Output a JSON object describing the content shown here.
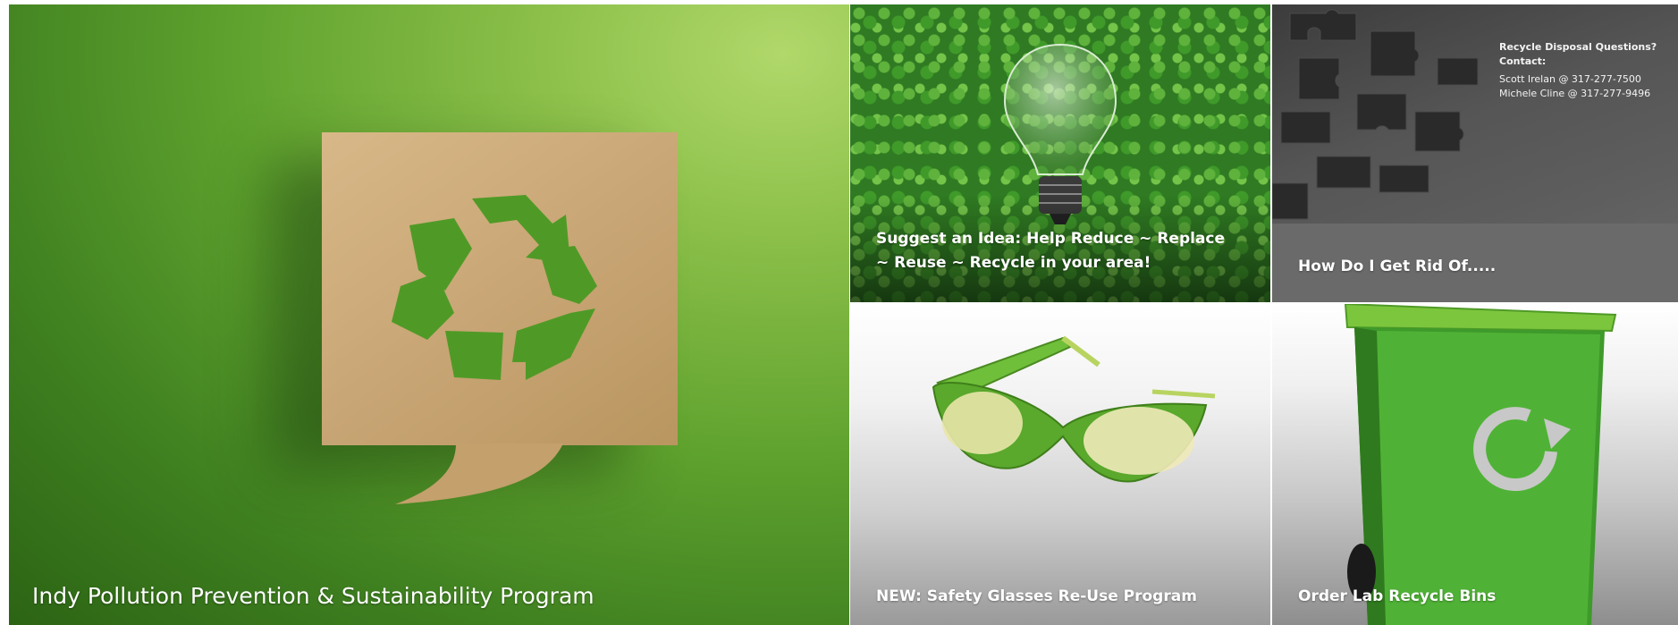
{
  "tiles": {
    "hero": {
      "caption": "Indy Pollution Prevention & Sustainability Program"
    },
    "bulb": {
      "caption": "Suggest an Idea: Help Reduce ~ Replace ~ Reuse ~ Recycle in your area!"
    },
    "puzzle": {
      "caption": "How Do I Get Rid Of.....",
      "contact_title": "Recycle Disposal Questions? Contact:",
      "contact_1": "Scott Irelan @ 317-277-7500",
      "contact_2": "Michele Cline @ 317-277-9496"
    },
    "glasses": {
      "caption": "NEW: Safety Glasses Re-Use Program"
    },
    "bin": {
      "caption": "Order Lab Recycle Bins"
    }
  },
  "icons": {
    "hero": "recycle-icon",
    "bulb": "lightbulb-icon",
    "puzzle": "puzzle-pieces-icon",
    "glasses": "safety-glasses-icon",
    "bin": "recycle-bin-icon"
  },
  "colors": {
    "accent_green": "#5fa22e",
    "caption_text": "#ffffff"
  }
}
